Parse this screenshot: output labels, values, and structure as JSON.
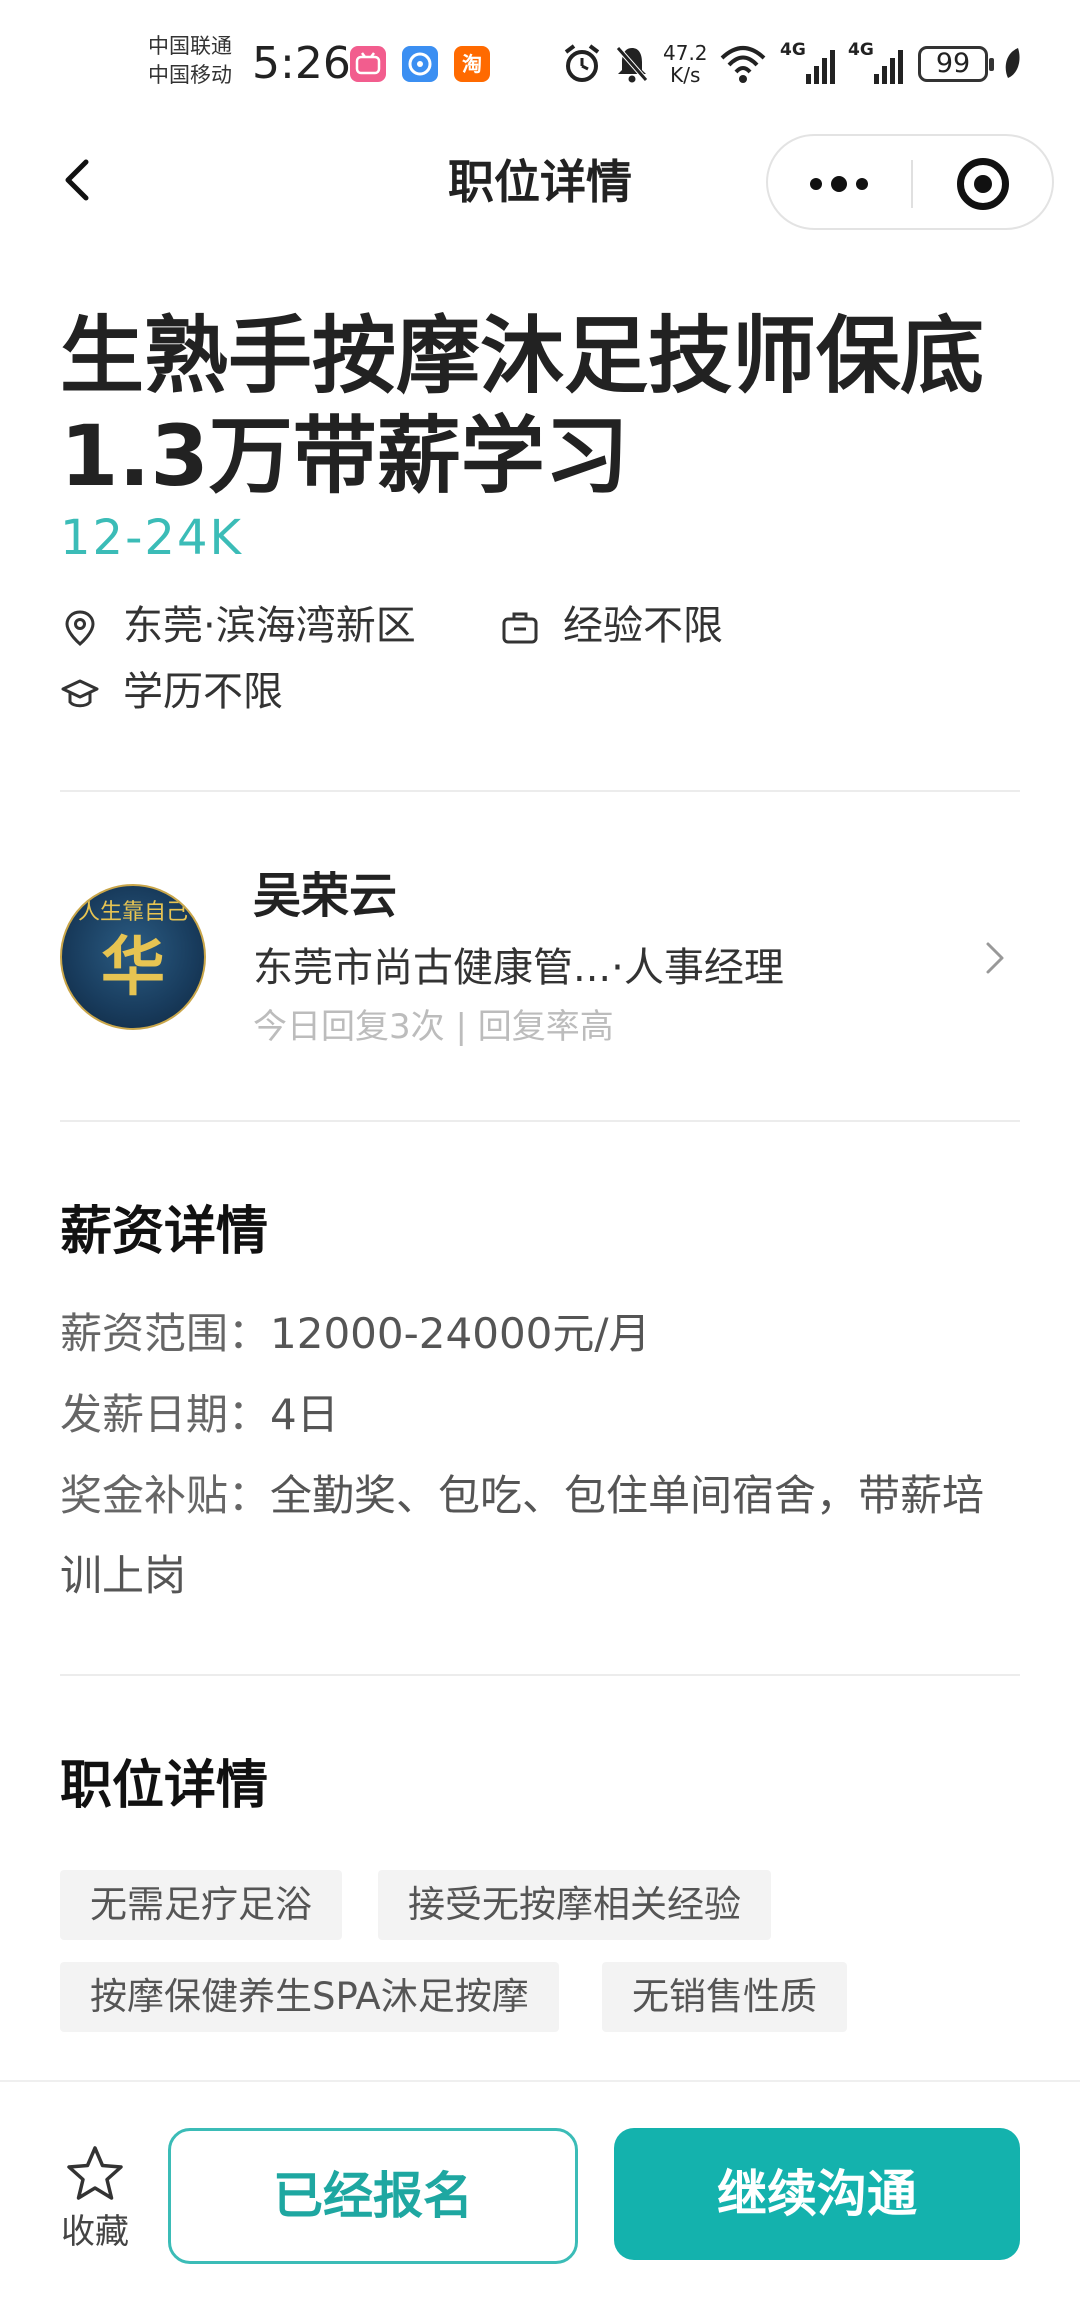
{
  "status_bar": {
    "carrier_1": "中国联通",
    "carrier_2": "中国移动",
    "time": "5:26",
    "net_speed_value": "47.2",
    "net_speed_unit": "K/s",
    "signal_1": "4G",
    "signal_2": "4G",
    "battery": "99",
    "app_icons": [
      "bilibili-icon",
      "assistant-icon",
      "taobao-icon"
    ],
    "taobao_glyph": "淘"
  },
  "nav": {
    "title": "职位详情"
  },
  "job": {
    "title": "生熟手按摩沐足技师保底1.3万带薪学习",
    "salary": "12-24K",
    "location": "东莞·滨海湾新区",
    "experience": "经验不限",
    "education": "学历不限"
  },
  "recruiter": {
    "name": "吴荣云",
    "company_role": "东莞市尚古健康管...·人事经理",
    "reply_stats": "今日回复3次 | 回复率高",
    "avatar_text": "华",
    "avatar_top_text": "人生靠自己"
  },
  "salary_section": {
    "title": "薪资详情",
    "range_label": "薪资范围：",
    "range_value": "12000-24000元/月",
    "payday_label": "发薪日期：",
    "payday_value": "4日",
    "bonus_label": "奖金补贴：",
    "bonus_value": "全勤奖、包吃、包住单间宿舍，带薪培训上岗"
  },
  "position_section": {
    "title": "职位详情",
    "tags": [
      "无需足疗足浴",
      "接受无按摩相关经验",
      "按摩保健养生SPA沐足按摩",
      "无销售性质"
    ]
  },
  "bottom_bar": {
    "favorite_label": "收藏",
    "applied_label": "已经报名",
    "chat_label": "继续沟通"
  },
  "colors": {
    "accent": "#3bbcb7",
    "button_primary": "#14b2ad",
    "text_main": "#222222",
    "text_muted": "#bcbcbc"
  }
}
